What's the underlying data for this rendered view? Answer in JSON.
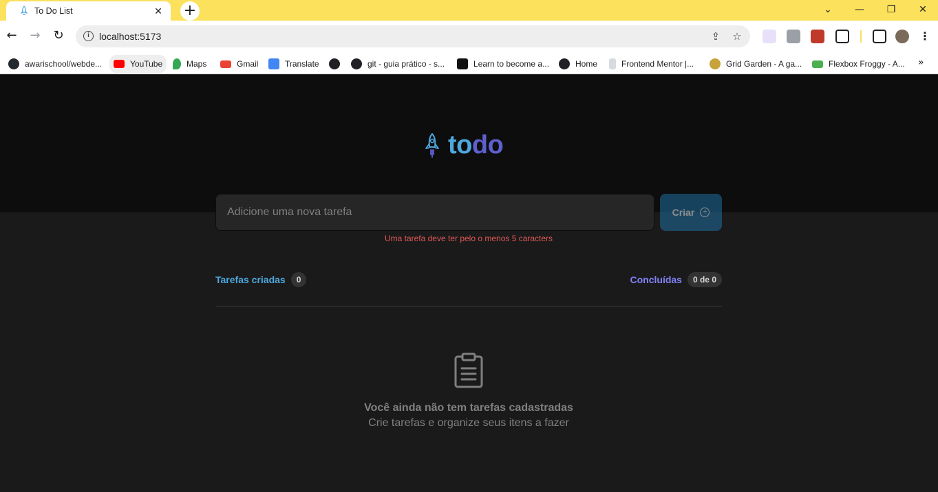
{
  "browser": {
    "tab_title": "To Do List",
    "tab_close": "✕",
    "new_tab": "+",
    "window_controls": [
      "⌄",
      "—",
      "❐",
      "✕"
    ],
    "url": "localhost:5173",
    "bookmarks": [
      {
        "label": "awarischool/webde...",
        "icon": "github-icon",
        "color": "#24292f"
      },
      {
        "label": "YouTube",
        "icon": "youtube-icon",
        "color": "#ff0000"
      },
      {
        "label": "Maps",
        "icon": "maps-icon",
        "color": "#34a853"
      },
      {
        "label": "Gmail",
        "icon": "gmail-icon",
        "color": "#ea4335"
      },
      {
        "label": "Translate",
        "icon": "translate-icon",
        "color": "#4285f4"
      },
      {
        "label": "",
        "icon": "globe-icon",
        "color": "#202124"
      },
      {
        "label": "git - guia prático - s...",
        "icon": "globe-icon",
        "color": "#202124"
      },
      {
        "label": "Learn to become a...",
        "icon": "roadmap-icon",
        "color": "#111111"
      },
      {
        "label": "Home",
        "icon": "globe-icon",
        "color": "#202124"
      },
      {
        "label": "Frontend Mentor |...",
        "icon": "frontend-mentor-icon",
        "color": "#9aa0a6"
      },
      {
        "label": "Grid Garden - A ga...",
        "icon": "grid-garden-icon",
        "color": "#c8a23a"
      },
      {
        "label": "Flexbox Froggy - A...",
        "icon": "flexbox-froggy-icon",
        "color": "#4caf50"
      }
    ],
    "bookmarks_more": "»"
  },
  "app": {
    "logo_to": "to",
    "logo_do": "do",
    "input_placeholder": "Adicione uma nova tarefa",
    "input_value": "",
    "create_label": "Criar",
    "error_message": "Uma tarefa deve ter pelo o menos 5 caracters",
    "created_label": "Tarefas criadas",
    "created_count": "0",
    "done_label": "Concluídas",
    "done_count": "0 de 0",
    "empty_title": "Você ainda não tem tarefas cadastradas",
    "empty_subtitle": "Crie tarefas e organize seus itens a fazer",
    "colors": {
      "blue": "#4ea8de",
      "purple": "#5e60ce",
      "purple_light": "#8284fa",
      "danger": "#e25858"
    }
  }
}
